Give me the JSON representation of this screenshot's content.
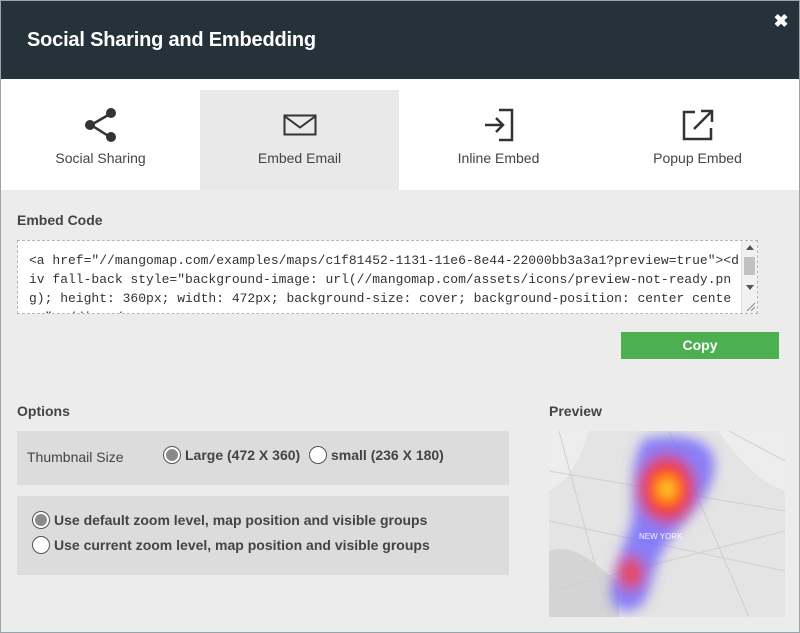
{
  "dialog": {
    "title": "Social Sharing and Embedding",
    "close_icon": "close-x-icon"
  },
  "tabs": [
    {
      "label": "Social Sharing",
      "icon": "share-icon",
      "active": false
    },
    {
      "label": "Embed Email",
      "icon": "envelope-icon",
      "active": true
    },
    {
      "label": "Inline Embed",
      "icon": "sign-in-arrow-icon",
      "active": false
    },
    {
      "label": "Popup Embed",
      "icon": "external-link-icon",
      "active": false
    }
  ],
  "embed": {
    "label": "Embed Code",
    "code": "<a href=\"//mangomap.com/examples/maps/c1f81452-1131-11e6-8e44-22000bb3a3a1?preview=true\"><div fall-back style=\"background-image: url(//mangomap.com/assets/icons/preview-not-ready.png); height: 360px; width: 472px; background-size: cover; background-position: center center;\"></div></a>",
    "copy_label": "Copy"
  },
  "options": {
    "label": "Options",
    "thumbnail_label": "Thumbnail Size",
    "sizes": [
      {
        "label": "Large (472 X 360)",
        "checked": true
      },
      {
        "label": "small (236 X 180)",
        "checked": false
      }
    ],
    "zoom_choices": [
      {
        "label": "Use default zoom level, map position and visible groups",
        "checked": true
      },
      {
        "label": "Use current zoom level, map position and visible groups",
        "checked": false
      }
    ]
  },
  "preview": {
    "label": "Preview",
    "map_label": "NEW YORK"
  },
  "colors": {
    "header_bg": "#263239",
    "copy_button": "#4caf50",
    "active_tab": "#e9e9e9"
  }
}
